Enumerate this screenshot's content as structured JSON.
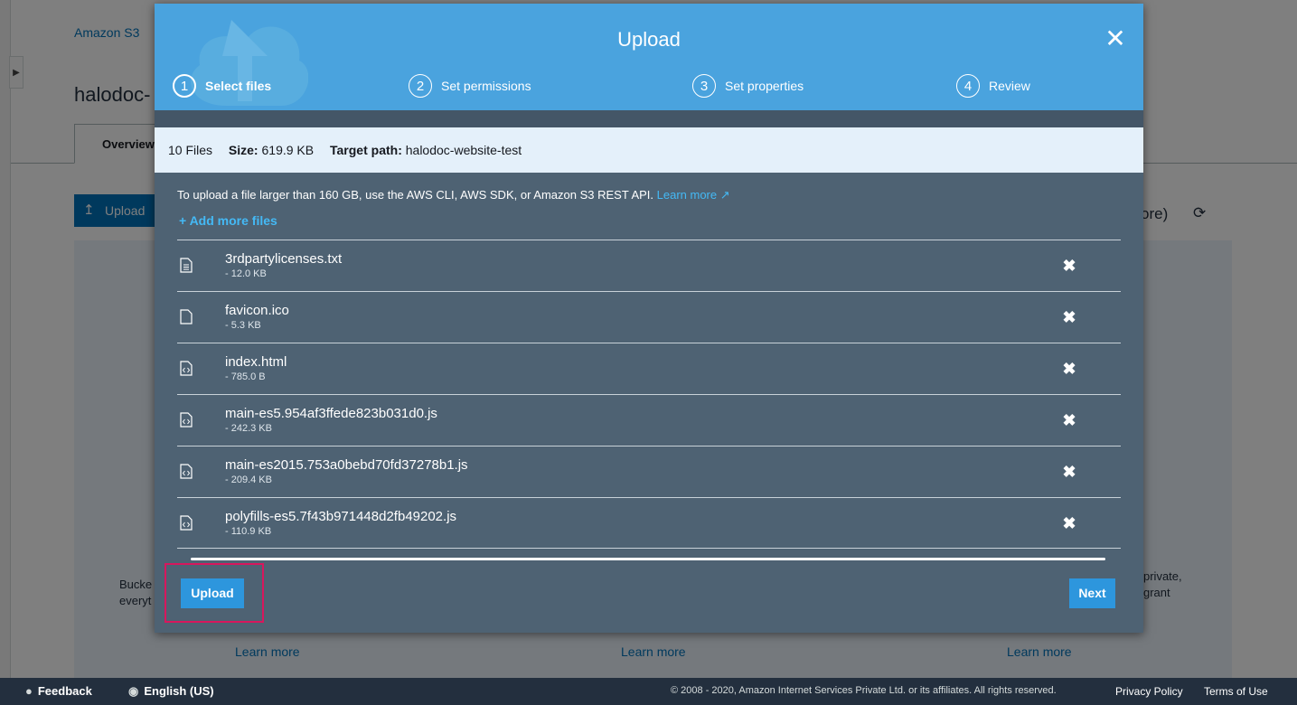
{
  "background": {
    "breadcrumb": "Amazon S3",
    "bucket_title": "halodoc-",
    "tab_overview": "Overview",
    "upload_button": "Upload",
    "more_text": "ore)",
    "left_text": [
      "Bucke",
      "everyt"
    ],
    "right_text": [
      "private,",
      "grant"
    ],
    "learn_more_links": [
      "Learn more",
      "Learn more",
      "Learn more"
    ]
  },
  "modal": {
    "title": "Upload",
    "steps": [
      {
        "number": "1",
        "label": "Select files",
        "active": true
      },
      {
        "number": "2",
        "label": "Set permissions",
        "active": false
      },
      {
        "number": "3",
        "label": "Set properties",
        "active": false
      },
      {
        "number": "4",
        "label": "Review",
        "active": false
      }
    ],
    "info": {
      "files_count": "10 Files",
      "size_label": "Size:",
      "size_value": "619.9 KB",
      "target_label": "Target path:",
      "target_value": "halodoc-website-test"
    },
    "notice_text": "To upload a file larger than 160 GB, use the AWS CLI, AWS SDK, or Amazon S3 REST API.",
    "notice_link": "Learn more",
    "add_more": "Add more files",
    "files": [
      {
        "name": "3rdpartylicenses.txt",
        "size": "- 12.0 KB",
        "icon": "text-file-icon"
      },
      {
        "name": "favicon.ico",
        "size": "- 5.3 KB",
        "icon": "file-icon"
      },
      {
        "name": "index.html",
        "size": "- 785.0 B",
        "icon": "code-file-icon"
      },
      {
        "name": "main-es5.954af3ffede823b031d0.js",
        "size": "- 242.3 KB",
        "icon": "code-file-icon"
      },
      {
        "name": "main-es2015.753a0bebd70fd37278b1.js",
        "size": "- 209.4 KB",
        "icon": "code-file-icon"
      },
      {
        "name": "polyfills-es5.7f43b971448d2fb49202.js",
        "size": "- 110.9 KB",
        "icon": "code-file-icon"
      }
    ],
    "upload_button": "Upload",
    "next_button": "Next"
  },
  "footer": {
    "feedback": "Feedback",
    "language": "English (US)",
    "copyright": "© 2008 - 2020, Amazon Internet Services Private Ltd. or its affiliates. All rights reserved.",
    "privacy": "Privacy Policy",
    "terms": "Terms of Use"
  },
  "colors": {
    "header_blue": "#4aa3de",
    "modal_body": "#4e6273",
    "link_blue": "#44b9f5",
    "button_blue": "#2d96dd",
    "highlight": "#d8175d"
  }
}
